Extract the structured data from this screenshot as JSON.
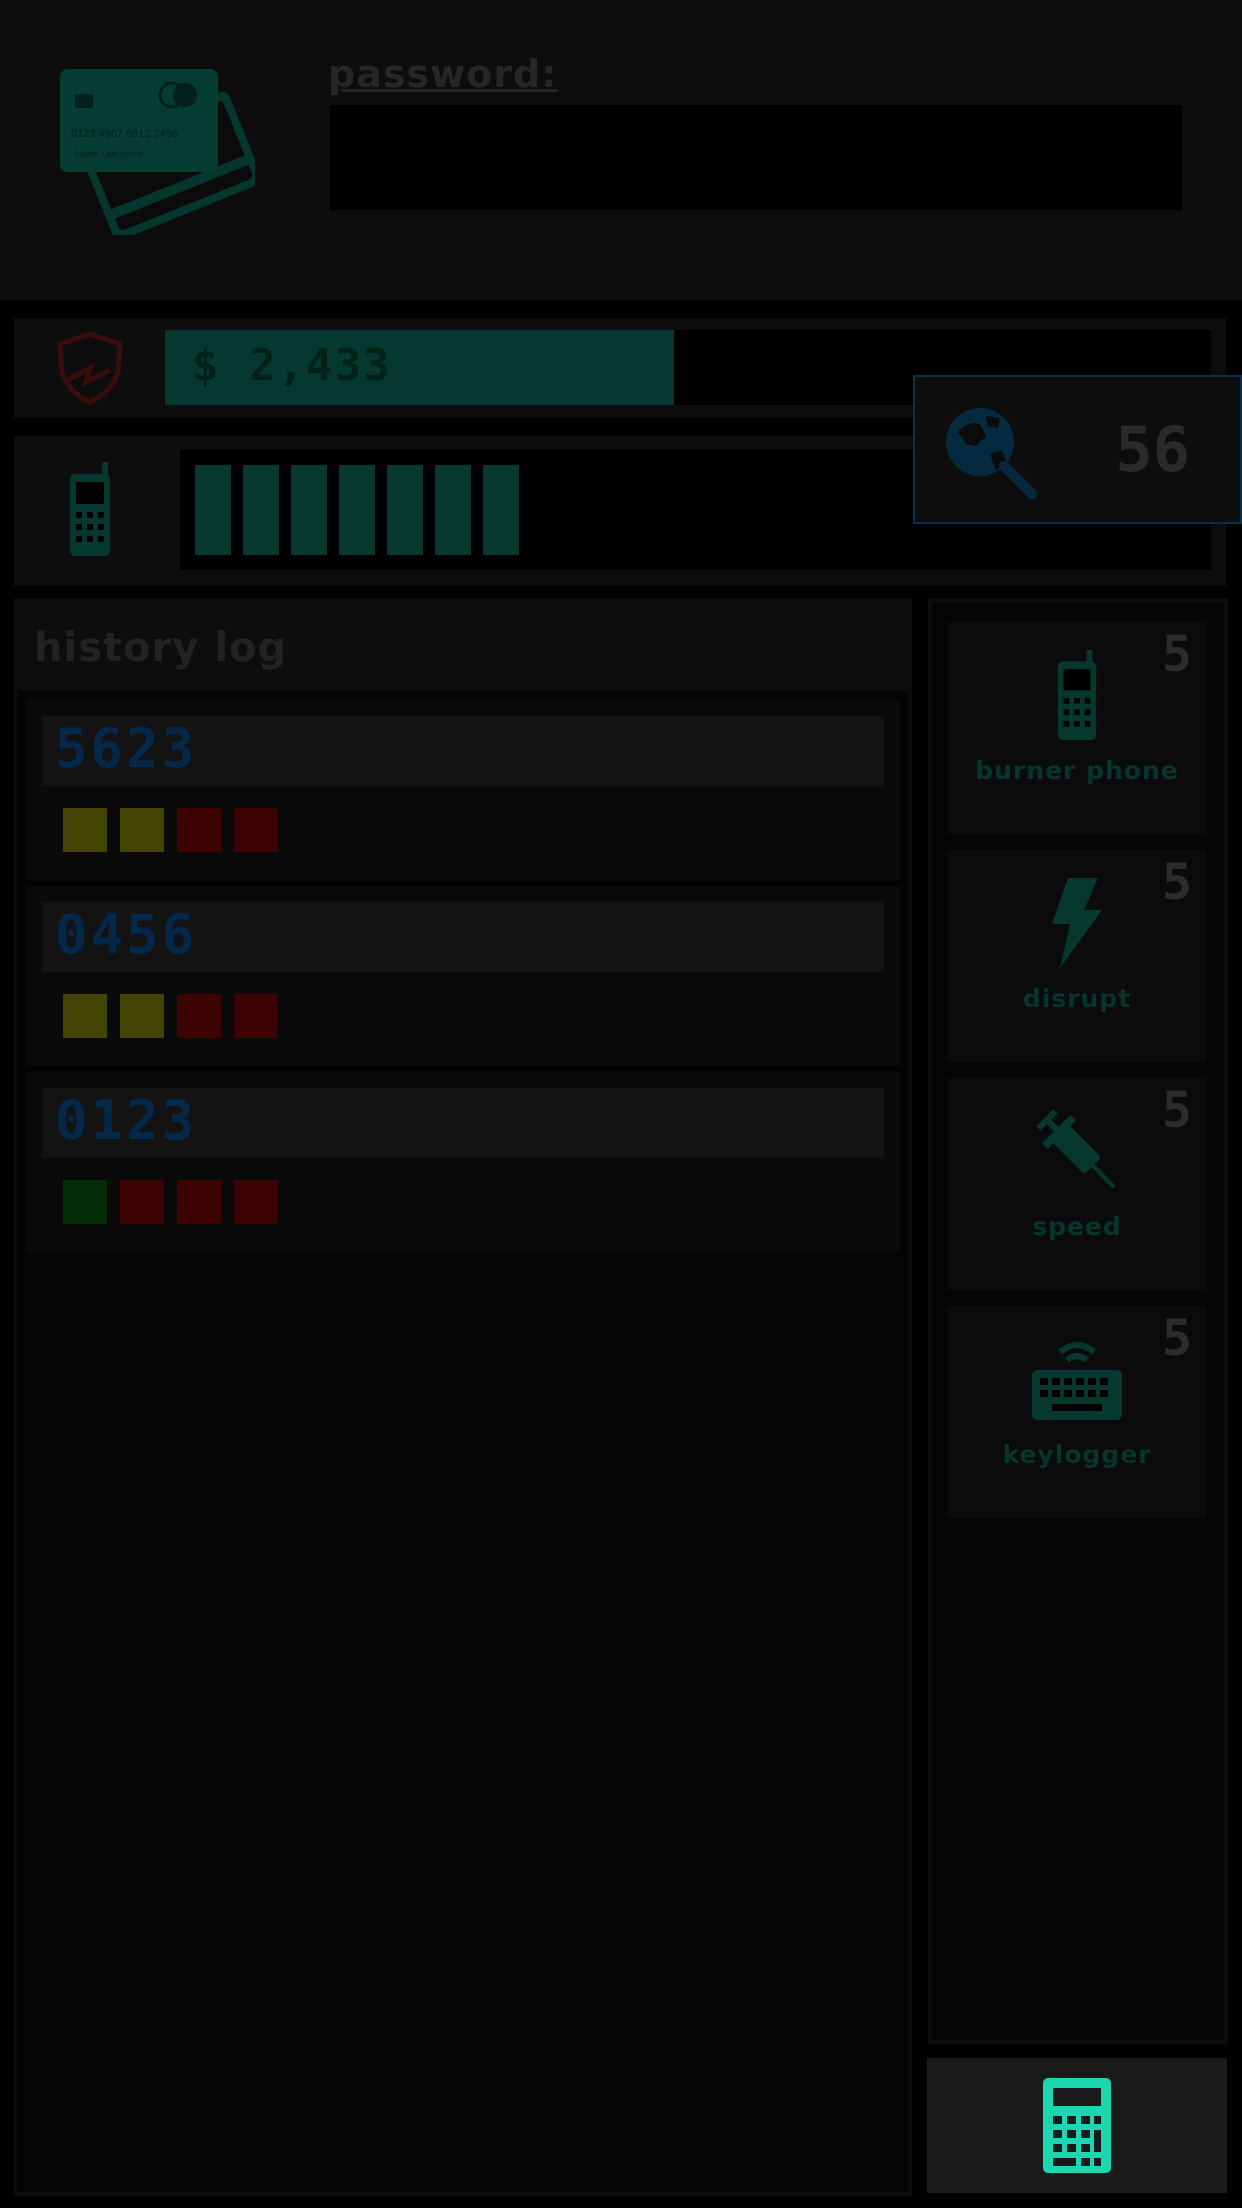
{
  "header": {
    "card": {
      "number": "0123  4567  8912  3456",
      "name": "Name  Last name"
    },
    "password_label": "password:",
    "password_value": ""
  },
  "money": {
    "text": "$ 2,433",
    "fill_fraction": 0.487,
    "icon": "shield-icon"
  },
  "signal": {
    "bars_filled": 7,
    "icon": "phone-icon"
  },
  "search": {
    "count": "56",
    "icon": "globe-search-icon"
  },
  "history": {
    "title": "history log",
    "entries": [
      {
        "code": "5623",
        "pips": [
          "yellow",
          "yellow",
          "red",
          "red"
        ]
      },
      {
        "code": "0456",
        "pips": [
          "yellow",
          "yellow",
          "red",
          "red"
        ]
      },
      {
        "code": "0123",
        "pips": [
          "green",
          "red",
          "red",
          "red"
        ]
      }
    ]
  },
  "inventory": {
    "items": [
      {
        "label": "burner phone",
        "count": "5",
        "icon": "phone-icon"
      },
      {
        "label": "disrupt",
        "count": "5",
        "icon": "lightning-icon"
      },
      {
        "label": "speed",
        "count": "5",
        "icon": "syringe-icon"
      },
      {
        "label": "keylogger",
        "count": "5",
        "icon": "keyboard-icon"
      }
    ]
  },
  "calculator": {
    "icon": "calculator-icon"
  },
  "colors": {
    "accent": "#06382e",
    "accent_bright": "#14b89a",
    "code_blue": "#04284a",
    "pip_yellow": "#444405",
    "pip_red": "#3d0303",
    "pip_green": "#032d05",
    "shield_red": "#3a0d0d"
  }
}
